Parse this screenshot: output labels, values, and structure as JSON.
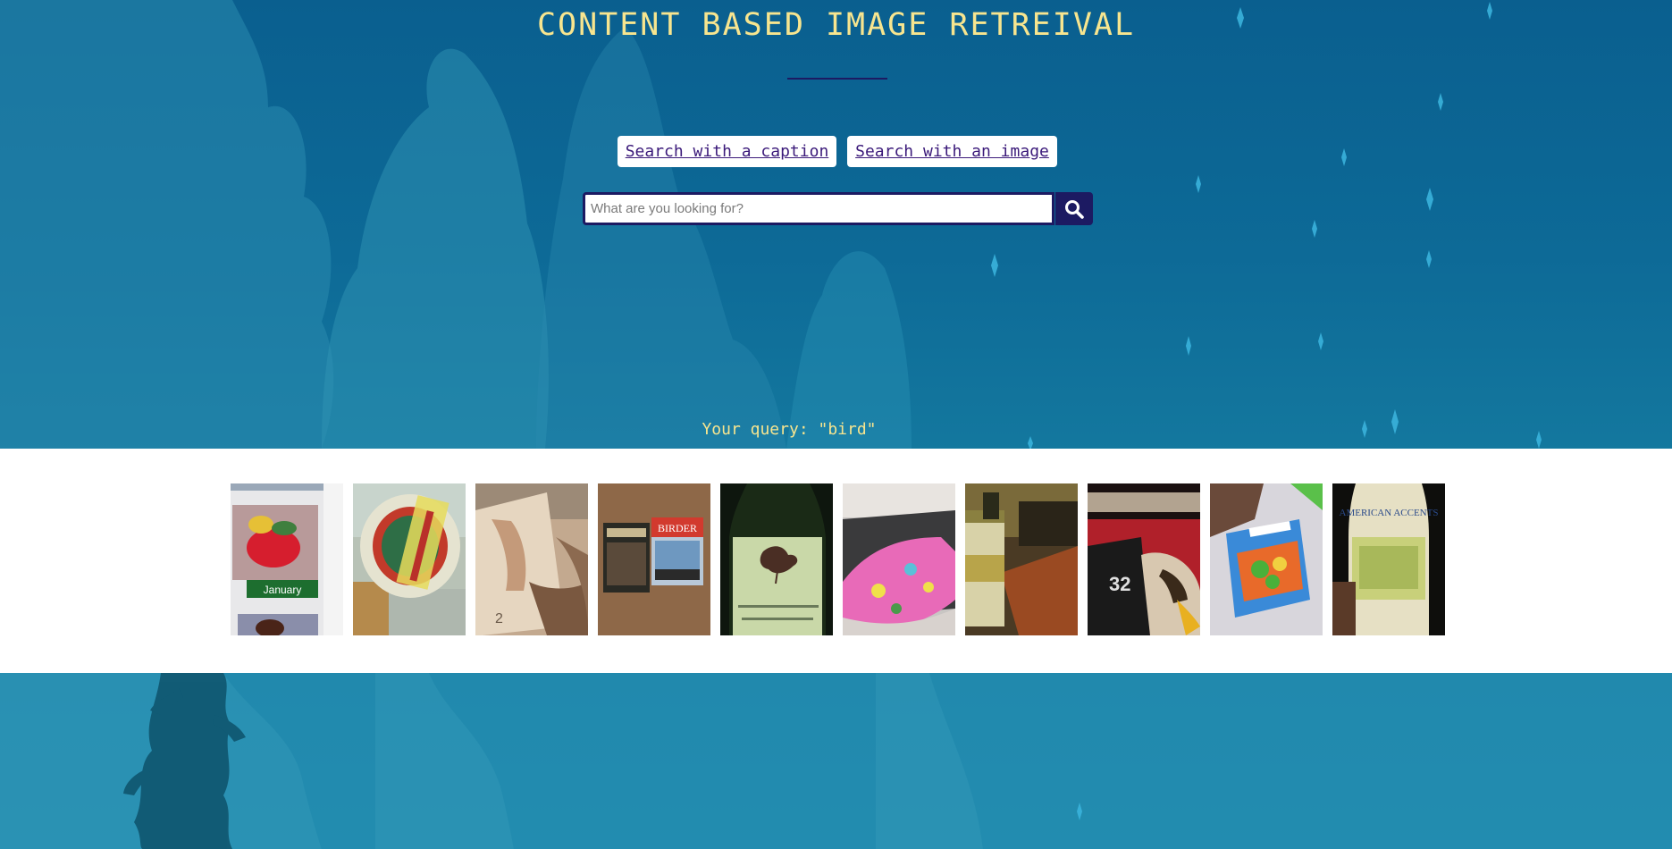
{
  "page": {
    "title": "CONTENT BASED IMAGE RETREIVAL"
  },
  "modes": {
    "caption_label": "Search with a caption",
    "image_label": "Search with an image"
  },
  "search": {
    "placeholder": "What are you looking for?",
    "value": "",
    "button_icon": "search-icon"
  },
  "query": {
    "label": "Your query: \"bird\""
  },
  "results": [
    {
      "subject": "bird-calendar",
      "caption": "January"
    },
    {
      "subject": "beer-can-label"
    },
    {
      "subject": "banknote-in-hand"
    },
    {
      "subject": "dvd-books-mash-birder",
      "caption": "BIRDER"
    },
    {
      "subject": "wine-bottle-bird-label"
    },
    {
      "subject": "colorful-fabric-on-couch"
    },
    {
      "subject": "jar-on-counter"
    },
    {
      "subject": "sports-jersey-32",
      "caption": "32"
    },
    {
      "subject": "frozen-vegetables-bag"
    },
    {
      "subject": "american-accents-bottle",
      "caption": "AMERICAN ACCENTS"
    }
  ],
  "colors": {
    "title": "#f7e58f",
    "accent": "#1c1a62",
    "link": "#3b1a7a",
    "background": "#0d6a97"
  }
}
